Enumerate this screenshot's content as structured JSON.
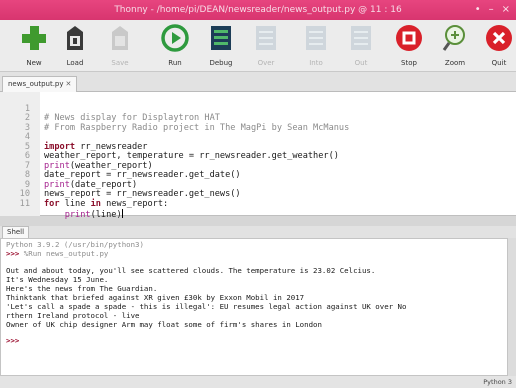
{
  "window": {
    "title": "Thonny - /home/pi/DEAN/newsreader/news_output.py @ 11 : 16",
    "controls": [
      "•",
      "–",
      "×"
    ]
  },
  "toolbar": {
    "items": [
      {
        "label": "New",
        "icon": "plus-icon",
        "enabled": true
      },
      {
        "label": "Load",
        "icon": "load-folder-icon",
        "enabled": true
      },
      {
        "label": "Save",
        "icon": "save-icon",
        "enabled": false
      },
      {
        "label": "Run",
        "icon": "run-play-icon",
        "enabled": true
      },
      {
        "label": "Debug",
        "icon": "debug-icon",
        "enabled": true
      },
      {
        "label": "Over",
        "icon": "step-over-icon",
        "enabled": false
      },
      {
        "label": "Into",
        "icon": "step-into-icon",
        "enabled": false
      },
      {
        "label": "Out",
        "icon": "step-out-icon",
        "enabled": false
      },
      {
        "label": "Stop",
        "icon": "stop-icon",
        "enabled": true
      },
      {
        "label": "Zoom",
        "icon": "zoom-icon",
        "enabled": true
      },
      {
        "label": "Quit",
        "icon": "quit-icon",
        "enabled": true
      }
    ]
  },
  "editor": {
    "tab_label": "news_output.py",
    "tab_close": "✕",
    "lines": [
      {
        "n": "1",
        "text": "# News display for Displaytron HAT",
        "kind": "comment"
      },
      {
        "n": "2",
        "text": "# From Raspberry Radio project in The MagPi by Sean McManus",
        "kind": "comment"
      },
      {
        "n": "3",
        "text": "",
        "kind": "blank"
      },
      {
        "n": "4",
        "kw": "import",
        "rest": " rr_newsreader",
        "kind": "kw"
      },
      {
        "n": "5",
        "text": "weather_report, temperature = rr_newsreader.get_weather()",
        "kind": "plain"
      },
      {
        "n": "6",
        "bi": "print",
        "rest": "(weather_report)",
        "kind": "bi"
      },
      {
        "n": "7",
        "text": "date_report = rr_newsreader.get_date()",
        "kind": "plain"
      },
      {
        "n": "8",
        "bi": "print",
        "rest": "(date_report)",
        "kind": "bi"
      },
      {
        "n": "9",
        "text": "news_report = rr_newsreader.get_news()",
        "kind": "plain"
      },
      {
        "n": "10",
        "kw": "for",
        "rest": " line ",
        "kw2": "in",
        "rest2": " news_report:",
        "kind": "for"
      },
      {
        "n": "11",
        "indent": "    ",
        "bi": "print",
        "rest": "(line)",
        "kind": "bi-cursor"
      }
    ]
  },
  "shell": {
    "tab_label": "Shell",
    "version_line": "Python 3.9.2 (/usr/bin/python3)",
    "prompt": ">>>",
    "run_command": " %Run news_output.py",
    "output": [
      "Out and about today, you'll see scattered clouds. The temperature is 23.02 Celcius.",
      "It's Wednesday 15 June.",
      "Here's the news from The Guardian.",
      "Thinktank that briefed against XR given £30k by Exxon Mobil in 2017",
      "'Let's call a spade a spade - this is illegal': EU resumes legal action against UK over No",
      "rthern Ireland protocol - live",
      "Owner of UK chip designer Arm may float some of firm's shares in London"
    ],
    "final_prompt": ">>>"
  },
  "status": {
    "interpreter": "Python 3"
  }
}
